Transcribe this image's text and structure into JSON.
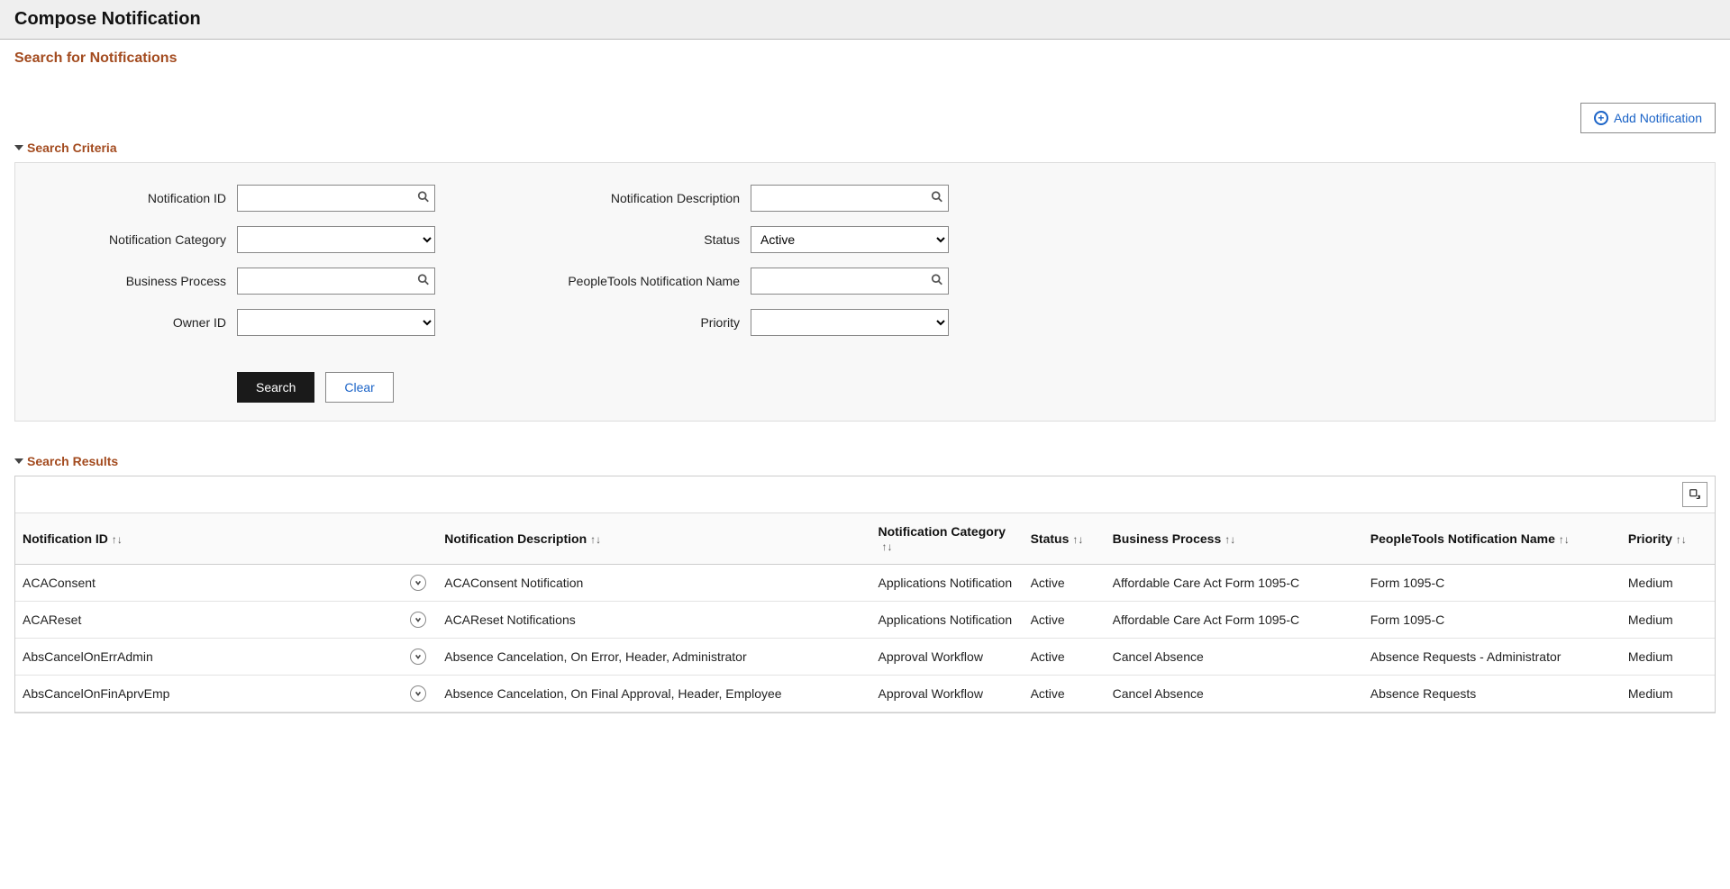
{
  "header": {
    "title": "Compose Notification"
  },
  "sub_title": "Search for Notifications",
  "add_btn_label": "Add Notification",
  "sections": {
    "criteria": "Search Criteria",
    "results": "Search Results"
  },
  "form": {
    "left": [
      {
        "label": "Notification ID",
        "type": "lookup",
        "value": ""
      },
      {
        "label": "Notification Category",
        "type": "select",
        "value": ""
      },
      {
        "label": "Business Process",
        "type": "lookup",
        "value": ""
      },
      {
        "label": "Owner ID",
        "type": "select",
        "value": ""
      }
    ],
    "right": [
      {
        "label": "Notification Description",
        "type": "lookup",
        "value": ""
      },
      {
        "label": "Status",
        "type": "select",
        "value": "Active"
      },
      {
        "label": "PeopleTools Notification Name",
        "type": "lookup",
        "value": ""
      },
      {
        "label": "Priority",
        "type": "select",
        "value": ""
      }
    ]
  },
  "buttons": {
    "search": "Search",
    "clear": "Clear"
  },
  "columns": [
    "Notification ID",
    "Notification Description",
    "Notification Category",
    "Status",
    "Business Process",
    "PeopleTools Notification Name",
    "Priority"
  ],
  "rows": [
    {
      "id": "ACAConsent",
      "desc": "ACAConsent Notification",
      "cat": "Applications Notification",
      "status": "Active",
      "bp": "Affordable Care Act Form 1095-C",
      "pt": "Form 1095-C",
      "prio": "Medium"
    },
    {
      "id": "ACAReset",
      "desc": "ACAReset Notifications",
      "cat": "Applications Notification",
      "status": "Active",
      "bp": "Affordable Care Act Form 1095-C",
      "pt": "Form 1095-C",
      "prio": "Medium"
    },
    {
      "id": "AbsCancelOnErrAdmin",
      "desc": "Absence Cancelation, On Error, Header, Administrator",
      "cat": "Approval Workflow",
      "status": "Active",
      "bp": "Cancel Absence",
      "pt": "Absence Requests - Administrator",
      "prio": "Medium"
    },
    {
      "id": "AbsCancelOnFinAprvEmp",
      "desc": "Absence Cancelation, On Final Approval, Header, Employee",
      "cat": "Approval Workflow",
      "status": "Active",
      "bp": "Cancel Absence",
      "pt": "Absence Requests",
      "prio": "Medium"
    }
  ]
}
